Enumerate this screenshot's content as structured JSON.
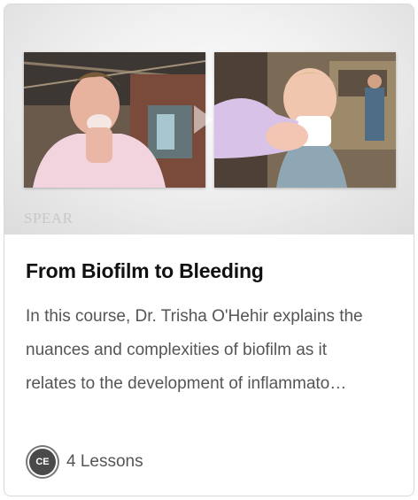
{
  "card": {
    "brand": "SPEAR",
    "title": "From Biofilm to Bleeding",
    "description_lines": [
      "In this course, Dr. Trisha O'Hehir explains the",
      "nuances and complexities of biofilm as it",
      "relates to the development of inflammato…"
    ],
    "badge": "CE",
    "lessons": "4 Lessons"
  },
  "icons": {
    "play": "play-icon",
    "badge": "ce-badge-icon"
  }
}
